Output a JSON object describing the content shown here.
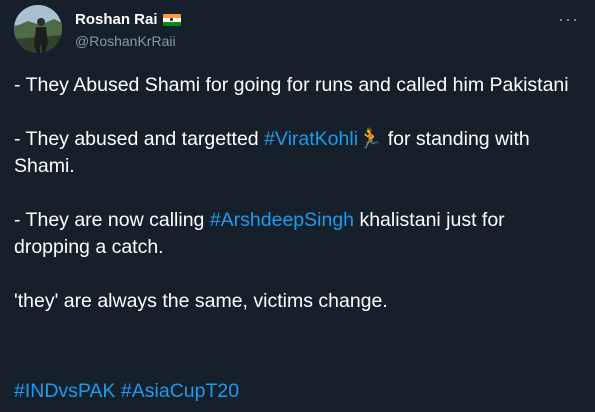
{
  "author": {
    "name": "Roshan Rai",
    "handle": "@RoshanKrRaii",
    "flag_icon": "india-flag-icon"
  },
  "menu": {
    "more_label": "···"
  },
  "tweet": {
    "p1": "- They Abused Shami for going for runs and called him Pakistani",
    "p2_a": "- They abused and targetted ",
    "p2_link": "#ViratKohli",
    "p2_emoji": "🏃",
    "p2_b": " for standing with Shami.",
    "p3_a": "- They are now calling ",
    "p3_link": "#ArshdeepSingh",
    "p3_b": " khalistani just for dropping a catch.",
    "p4": "'they' are always the same, victims change.",
    "hashtag1": "#INDvsPAK",
    "hashtag2": "#AsiaCupT20"
  },
  "colors": {
    "background": "#15202b",
    "link": "#1d9bf0",
    "secondary_text": "#8b98a5"
  }
}
